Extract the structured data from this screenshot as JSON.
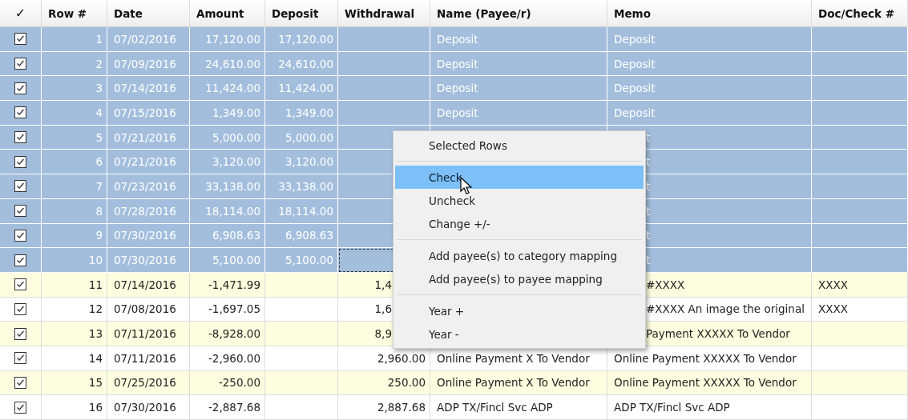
{
  "table": {
    "columns": [
      "✓",
      "Row #",
      "Date",
      "Amount",
      "Deposit",
      "Withdrawal",
      "Name (Payee/r)",
      "Memo",
      "Doc/Check #"
    ],
    "rows": [
      {
        "checked": true,
        "selected": true,
        "under_menu": false,
        "focused": false,
        "row": "1",
        "date": "07/02/2016",
        "amount": "17,120.00",
        "deposit": "17,120.00",
        "name": "Deposit",
        "memo": "Deposit"
      },
      {
        "checked": true,
        "selected": true,
        "under_menu": false,
        "focused": false,
        "row": "2",
        "date": "07/09/2016",
        "amount": "24,610.00",
        "deposit": "24,610.00",
        "name": "Deposit",
        "memo": "Deposit"
      },
      {
        "checked": true,
        "selected": true,
        "under_menu": false,
        "focused": false,
        "row": "3",
        "date": "07/14/2016",
        "amount": "11,424.00",
        "deposit": "11,424.00",
        "name": "Deposit",
        "memo": "Deposit"
      },
      {
        "checked": true,
        "selected": true,
        "under_menu": false,
        "focused": false,
        "row": "4",
        "date": "07/15/2016",
        "amount": "1,349.00",
        "deposit": "1,349.00",
        "name": "Deposit",
        "memo": "Deposit"
      },
      {
        "checked": true,
        "selected": true,
        "under_menu": true,
        "focused": false,
        "row": "5",
        "date": "07/21/2016",
        "amount": "5,000.00",
        "deposit": "5,000.00",
        "memo": "t"
      },
      {
        "checked": true,
        "selected": true,
        "under_menu": true,
        "focused": false,
        "row": "6",
        "date": "07/21/2016",
        "amount": "3,120.00",
        "deposit": "3,120.00",
        "memo": "t"
      },
      {
        "checked": true,
        "selected": true,
        "under_menu": true,
        "focused": false,
        "row": "7",
        "date": "07/23/2016",
        "amount": "33,138.00",
        "deposit": "33,138.00",
        "memo": "t"
      },
      {
        "checked": true,
        "selected": true,
        "under_menu": true,
        "focused": false,
        "row": "8",
        "date": "07/28/2016",
        "amount": "18,114.00",
        "deposit": "18,114.00",
        "memo": "t"
      },
      {
        "checked": true,
        "selected": true,
        "under_menu": true,
        "focused": false,
        "row": "9",
        "date": "07/30/2016",
        "amount": "6,908.63",
        "deposit": "6,908.63",
        "memo": "t"
      },
      {
        "checked": true,
        "selected": true,
        "under_menu": true,
        "focused": true,
        "row": "10",
        "date": "07/30/2016",
        "amount": "5,100.00",
        "deposit": "5,100.00",
        "memo": "t"
      },
      {
        "checked": true,
        "selected": false,
        "under_menu": true,
        "focused": false,
        "row": "11",
        "date": "07/14/2016",
        "amount": "-1,471.99",
        "withdrawal": "1,4",
        "memo": "#XXXX",
        "doc": "XXXX"
      },
      {
        "checked": true,
        "selected": false,
        "under_menu": true,
        "focused": false,
        "row": "12",
        "date": "07/08/2016",
        "amount": "-1,697.05",
        "withdrawal": "1,6",
        "memo": "#XXXX An image the original",
        "doc": "XXXX"
      },
      {
        "checked": true,
        "selected": false,
        "under_menu": true,
        "focused": false,
        "row": "13",
        "date": "07/11/2016",
        "amount": "-8,928.00",
        "withdrawal": "8,9",
        "memo": "Payment XXXXX To Vendor"
      },
      {
        "checked": true,
        "selected": false,
        "under_menu": false,
        "focused": false,
        "row": "14",
        "date": "07/11/2016",
        "amount": "-2,960.00",
        "withdrawal": "2,960.00",
        "name": "Online Payment X To Vendor",
        "memo": "Online Payment XXXXX To Vendor"
      },
      {
        "checked": true,
        "selected": false,
        "under_menu": false,
        "focused": false,
        "row": "15",
        "date": "07/25/2016",
        "amount": "-250.00",
        "withdrawal": "250.00",
        "name": "Online Payment X To Vendor",
        "memo": "Online Payment XXXXX To Vendor"
      },
      {
        "checked": true,
        "selected": false,
        "under_menu": false,
        "focused": false,
        "row": "16",
        "date": "07/30/2016",
        "amount": "-2,887.68",
        "withdrawal": "2,887.68",
        "name": "ADP TX/Fincl Svc ADP",
        "memo": "ADP TX/Fincl Svc ADP"
      }
    ]
  },
  "context_menu": {
    "groups": [
      [
        {
          "label": "Selected Rows",
          "selected": false
        }
      ],
      [
        {
          "label": "Check",
          "selected": true
        },
        {
          "label": "Uncheck",
          "selected": false
        },
        {
          "label": "Change +/-",
          "selected": false
        }
      ],
      [
        {
          "label": "Add payee(s) to category mapping",
          "selected": false
        },
        {
          "label": "Add payee(s) to payee mapping",
          "selected": false
        }
      ],
      [
        {
          "label": "Year +",
          "selected": false
        },
        {
          "label": "Year -",
          "selected": false
        }
      ]
    ]
  }
}
